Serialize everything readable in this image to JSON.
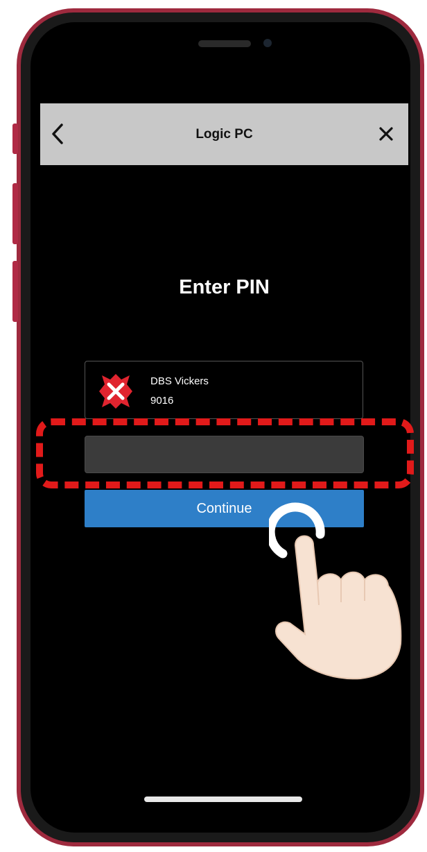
{
  "nav": {
    "title": "Logic PC",
    "back_icon": "chevron-left-icon",
    "close_icon": "close-icon"
  },
  "heading": "Enter PIN",
  "account": {
    "logo_icon": "dbs-logo-icon",
    "name": "DBS Vickers",
    "number": "9016"
  },
  "pin_input": {
    "value": "",
    "placeholder": ""
  },
  "continue_button": {
    "label": "Continue"
  },
  "colors": {
    "frame": "#9e2a3e",
    "nav_bar": "#c8c8c8",
    "continue_button": "#2e7fc8",
    "highlight": "#e11a1a",
    "logo_red": "#e0242f"
  }
}
